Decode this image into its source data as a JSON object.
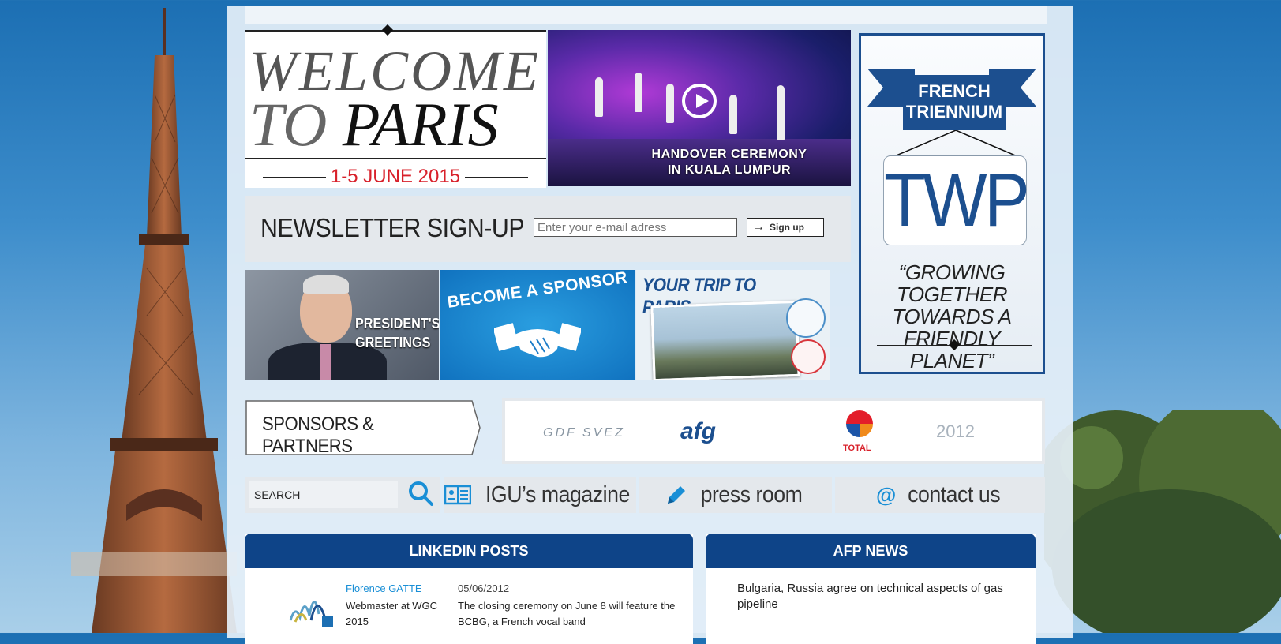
{
  "welcome": {
    "line1": "WELCOME",
    "line2_to": "TO",
    "line2_paris": "PARIS",
    "date": "1-5 JUNE 2015"
  },
  "handover": {
    "caption_line1": "HANDOVER CEREMONY",
    "caption_line2": "IN KUALA LUMPUR"
  },
  "triennium": {
    "ribbon_line1": "FRENCH",
    "ribbon_line2": "TRIENNIUM",
    "logo": "TWP",
    "motto_line1": "“GROWING TOGETHER",
    "motto_line2": "TOWARDS  A",
    "motto_line3": "FRIENDLY PLANET”"
  },
  "newsletter": {
    "title": "NEWSLETTER SIGN-UP",
    "email_placeholder": "Enter your e-mail adress",
    "signup_label": "Sign up"
  },
  "tiles": {
    "president_line1": "PRESIDENT'S",
    "president_line2": "GREETINGS",
    "sponsor_label": "BECOME A SPONSOR",
    "trip_label": "YOUR TRIP TO PARIS"
  },
  "sponsors": {
    "label": "SPONSORS & PARTNERS",
    "logos": [
      "GDF SVEZ",
      "afg",
      "TOTAL",
      "2012"
    ]
  },
  "nav": {
    "search_placeholder": "SEARCH",
    "magazine": "IGU’s magazine",
    "press": "press room",
    "contact_at": "@",
    "contact": "contact us"
  },
  "linkedin": {
    "header": "LINKEDIN POSTS",
    "author": "Florence GATTE",
    "role": "Webmaster at WGC 2015",
    "date": "05/06/2012",
    "text": "The closing ceremony on June 8 will feature the BCBG, a French vocal band"
  },
  "afp": {
    "header": "AFP NEWS",
    "headline": "Bulgaria, Russia agree on technical aspects of gas pipeline"
  },
  "colors": {
    "brand_blue": "#1c4f8f",
    "header_blue": "#0e4488",
    "date_red": "#d8202a",
    "accent_cyan": "#1a8fd6"
  }
}
